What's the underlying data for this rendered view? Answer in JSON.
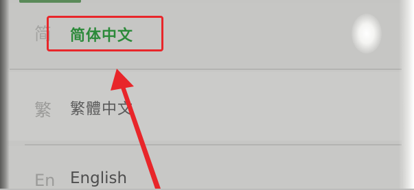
{
  "language_list": {
    "items": [
      {
        "prefix": "简",
        "label": "简体中文",
        "selected": true
      },
      {
        "prefix": "繁",
        "label": "繁體中文",
        "selected": false
      },
      {
        "prefix": "En",
        "label": "English",
        "selected": false
      }
    ]
  },
  "colors": {
    "selected_text": "#2c8a3a",
    "annotation": "#e8262a",
    "background": "#c8c8c6"
  },
  "icons": {
    "annotation_arrow": "red-arrow-icon"
  }
}
